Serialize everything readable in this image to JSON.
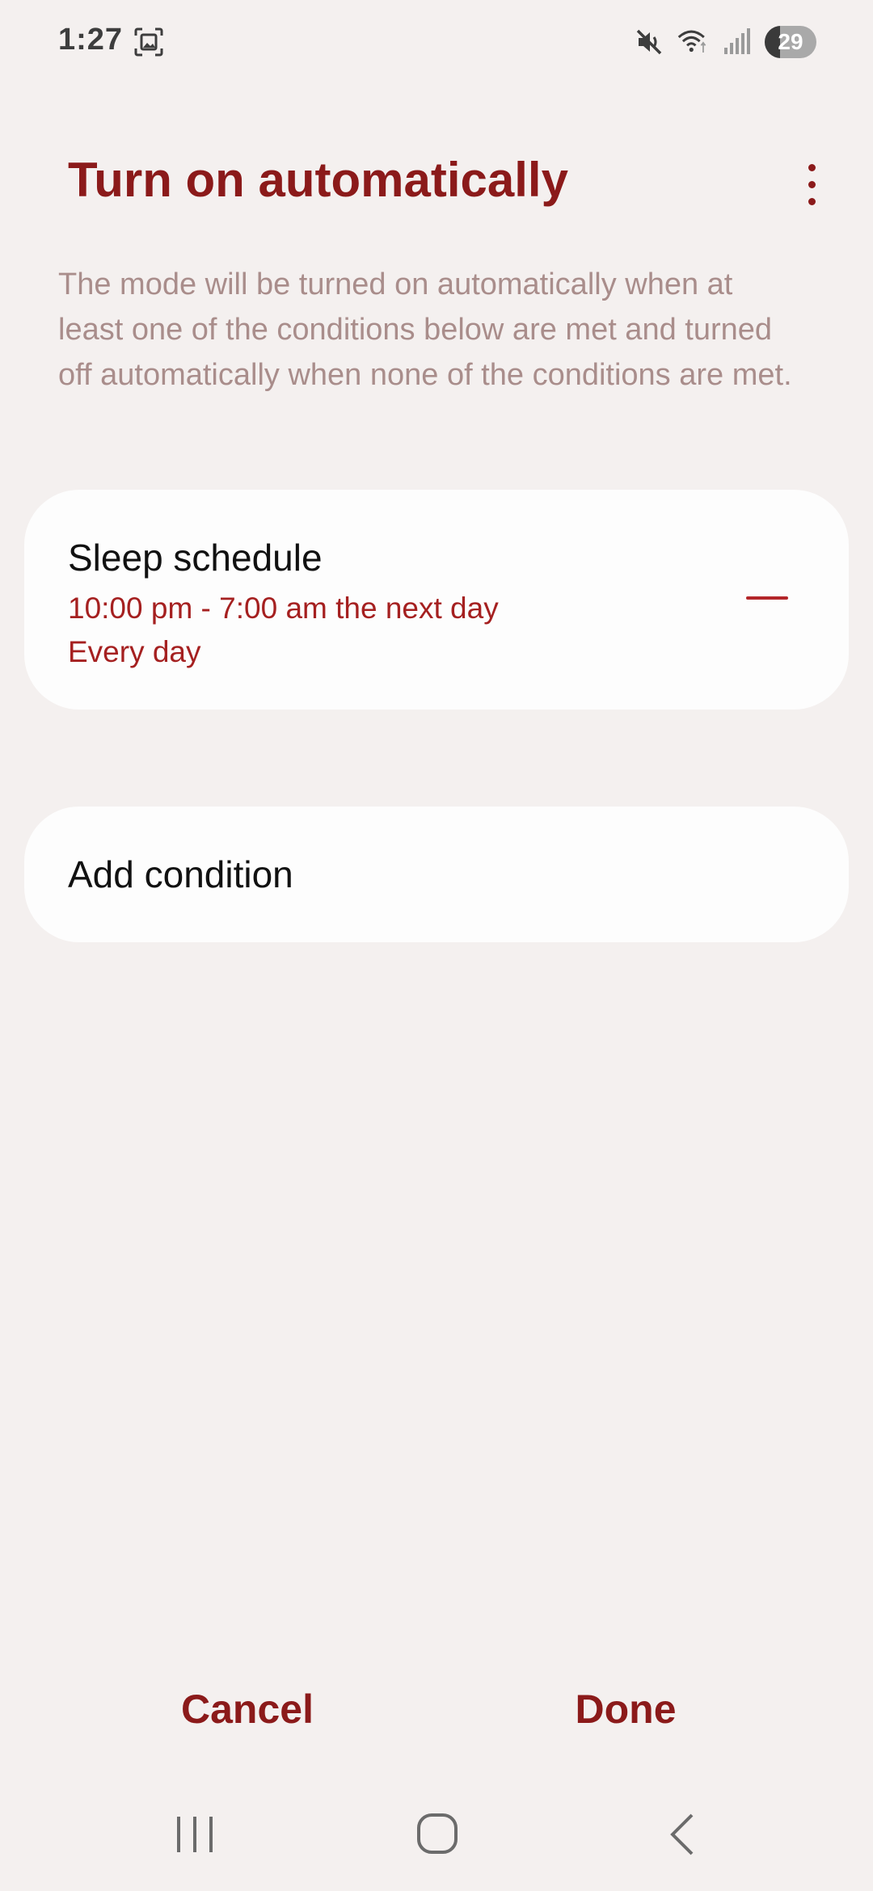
{
  "status_bar": {
    "time": "1:27",
    "battery_level": "29",
    "battery_fraction": 0.29,
    "icons": [
      "screenshot-icon",
      "mute-icon",
      "wifi-icon",
      "signal-icon",
      "battery-icon"
    ]
  },
  "header": {
    "title": "Turn on automatically",
    "menu_icon": "more-vertical-icon"
  },
  "description": "The mode will be turned on automatically when at least one of the conditions below are met and turned off automatically when none of the conditions are met.",
  "conditions": [
    {
      "title": "Sleep schedule",
      "time": "10:00  pm - 7:00  am the next day",
      "days": "Every day",
      "action_icon": "minus-icon"
    }
  ],
  "add_condition": {
    "label": "Add condition"
  },
  "actions": {
    "cancel": "Cancel",
    "done": "Done"
  },
  "navigation": {
    "icons": [
      "recents-icon",
      "home-icon",
      "back-icon"
    ]
  },
  "colors": {
    "accent": "#8b1a1a",
    "subtitle": "#a52020",
    "description": "#a98d8b",
    "background": "#f4f0ef",
    "card": "#fdfdfd"
  }
}
